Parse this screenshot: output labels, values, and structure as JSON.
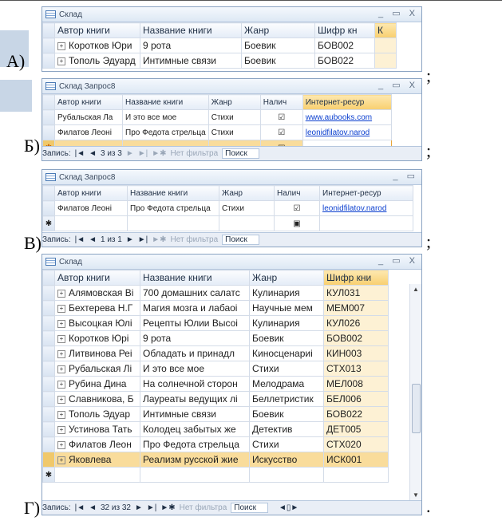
{
  "options": {
    "a": "А)",
    "b": "Б)",
    "v": "В)",
    "g": "Г)",
    "sep_a": ";",
    "sep_b": ";",
    "sep_v": ";",
    "sep_g": "."
  },
  "winA": {
    "title": "Склад",
    "controls": "_ ▭ X",
    "headers": [
      "Автор книги",
      "Название книги",
      "Жанр",
      "Шифр кн",
      "К"
    ],
    "rows": [
      [
        "Коротков Юри",
        "9 рота",
        "Боевик",
        "БОВ002"
      ],
      [
        "Тополь Эдуард",
        "Интимные связи",
        "Боевик",
        "БОВ022"
      ]
    ]
  },
  "winB": {
    "title": "Склад Запрос8",
    "controls": "_ ▭ X",
    "headers": [
      "Автор книги",
      "Название книги",
      "Жанр",
      "Налич",
      "Интернет-ресур"
    ],
    "rows": [
      [
        "Рубальская Ла",
        "И это все мое",
        "Стихи",
        "☑",
        "www.aubooks.com"
      ],
      [
        "Филатов Леоні",
        "Про Федота стрельца",
        "Стихи",
        "☑",
        "leonidfilatov.narod"
      ]
    ],
    "newrow_check": "▣",
    "nav": {
      "label": "Запись:",
      "first": "|◄",
      "prev": "◄",
      "pos": "3 из 3",
      "next": "►",
      "last": "►|",
      "newrec": "►✱",
      "filter": "Нет фильтра",
      "search": "Поиск"
    }
  },
  "winV": {
    "title": "Склад Запрос8",
    "controls": "_ ▭",
    "headers": [
      "Автор книги",
      "Название книги",
      "Жанр",
      "Налич",
      "Интернет-ресур"
    ],
    "rows": [
      [
        "Филатов Леоні",
        "Про Федота стрельца",
        "Стихи",
        "☑",
        "leonidfilatov.narod"
      ]
    ],
    "newrow_check": "▣",
    "nav": {
      "label": "Запись:",
      "first": "|◄",
      "prev": "◄",
      "pos": "1 из 1",
      "next": "►",
      "last": "►|",
      "newrec": "►✱",
      "filter": "Нет фильтра",
      "search": "Поиск"
    }
  },
  "winG": {
    "title": "Склад",
    "controls": "_ ▭ X",
    "headers": [
      "Автор книги",
      "Название книги",
      "Жанр",
      "Шифр кни"
    ],
    "rows": [
      [
        "Алямовская Ві",
        "700 домашних салатс",
        "Кулинария",
        "КУЛ031"
      ],
      [
        "Бехтерева Н.Г",
        "Магия мозга и лабаоі",
        "Научные мем",
        "МЕМ007"
      ],
      [
        "Высоцкая Юлі",
        "Рецепты Юлии Высоі",
        "Кулинария",
        "КУЛ026"
      ],
      [
        "Коротков Юрі",
        "9 рота",
        "Боевик",
        "БОВ002"
      ],
      [
        "Литвинова Реі",
        "Обладать и принадл",
        "Киносценариі",
        "КИН003"
      ],
      [
        "Рубальская Лі",
        "И это все мое",
        "Стихи",
        "СТХ013"
      ],
      [
        "Рубина Дина",
        "На солнечной сторон",
        "Мелодрама",
        "МЕЛ008"
      ],
      [
        "Славникова, Б",
        "Лауреаты ведущих лі",
        "Беллетристик",
        "БЕЛ006"
      ],
      [
        "Тополь Эдуар",
        "Интимные связи",
        "Боевик",
        "БОВ022"
      ],
      [
        "Устинова Тать",
        "Колодец забытых же",
        "Детектив",
        "ДЕТ005"
      ],
      [
        "Филатов Леон",
        "Про Федота стрельца",
        "Стихи",
        "СТХ020"
      ],
      [
        "Яковлева",
        "Реализм русской жие",
        "Искусство",
        "ИСК001"
      ]
    ],
    "nav": {
      "label": "Запись:",
      "first": "|◄",
      "prev": "◄",
      "pos": "32 из 32",
      "next": "►",
      "last": "►|",
      "newrec": "►✱",
      "filter": "Нет фильтра",
      "search": "Поиск"
    }
  }
}
